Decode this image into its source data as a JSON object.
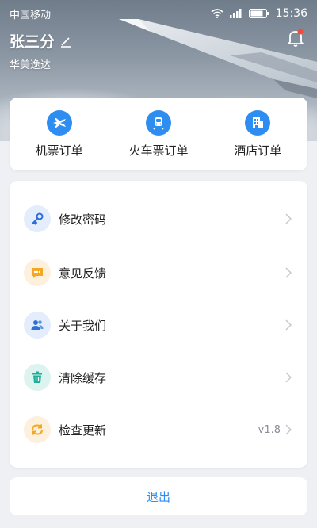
{
  "status_bar": {
    "carrier": "中国移动",
    "time": "15:36"
  },
  "profile": {
    "user_name": "张三分",
    "company": "华美逸达"
  },
  "orders": [
    {
      "label": "机票订单",
      "icon": "airplane-icon"
    },
    {
      "label": "火车票订单",
      "icon": "train-icon"
    },
    {
      "label": "酒店订单",
      "icon": "hotel-icon"
    }
  ],
  "menu": [
    {
      "label": "修改密码",
      "icon": "key-icon",
      "value": ""
    },
    {
      "label": "意见反馈",
      "icon": "message-icon",
      "value": ""
    },
    {
      "label": "关于我们",
      "icon": "users-icon",
      "value": ""
    },
    {
      "label": "清除缓存",
      "icon": "trash-icon",
      "value": ""
    },
    {
      "label": "检查更新",
      "icon": "refresh-icon",
      "value": "v1.8"
    }
  ],
  "logout_label": "退出",
  "colors": {
    "accent": "#2d8df0",
    "background": "#eef0f4",
    "key_icon_bg": "#e4edfb",
    "message_icon_bg": "#fdf0dd",
    "users_icon_bg": "#e4edfb",
    "trash_icon_bg": "#ddf3ef",
    "refresh_icon_bg": "#fdf0dd"
  }
}
